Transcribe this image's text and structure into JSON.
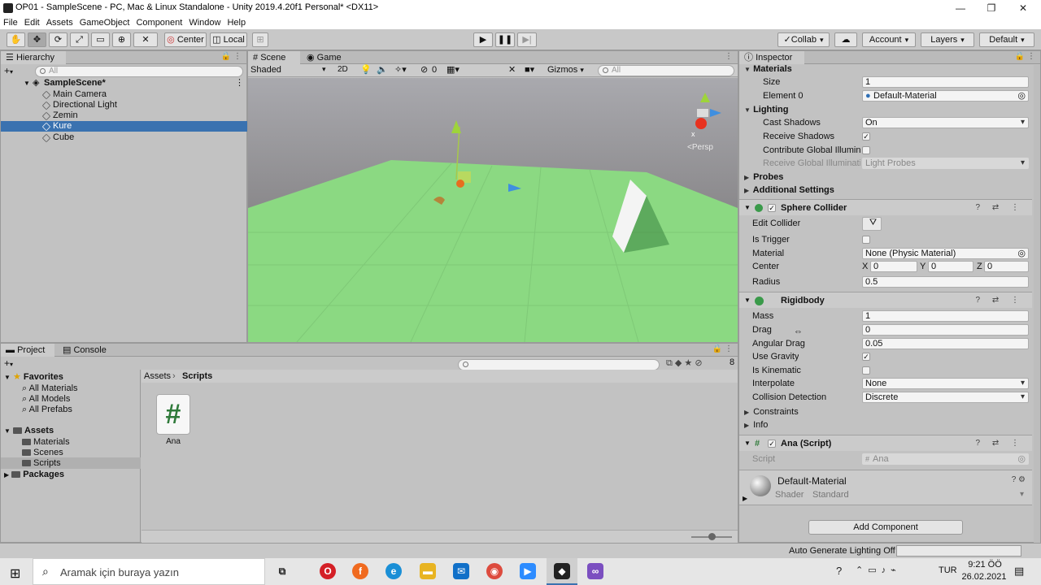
{
  "window": {
    "title": "OP01 - SampleScene - PC, Mac & Linux Standalone - Unity 2019.4.20f1 Personal* <DX11>",
    "minimize": "—",
    "maximize": "❐",
    "close": "✕"
  },
  "menu": [
    "File",
    "Edit",
    "Assets",
    "GameObject",
    "Component",
    "Window",
    "Help"
  ],
  "toolbar": {
    "pivot": "Center",
    "space": "Local",
    "collab": "Collab",
    "account": "Account",
    "layers": "Layers",
    "layout": "Default"
  },
  "hierarchy": {
    "tab": "Hierarchy",
    "add": "+",
    "search_placeholder": "All",
    "scene": "SampleScene*",
    "items": [
      "Main Camera",
      "Directional Light",
      "Zemin",
      "Kure",
      "Cube"
    ],
    "selected": "Kure"
  },
  "scene_view": {
    "tabs": [
      "Scene",
      "Game"
    ],
    "shading": "Shaded",
    "mode2d": "2D",
    "fx_count": "0",
    "gizmos": "Gizmos",
    "search_placeholder": "All",
    "persp": "<Persp",
    "axis_x": "x",
    "colors": {
      "sky": "#8a8a8f",
      "ground": "#8bd982",
      "horizon": "#58534f"
    }
  },
  "project": {
    "tabs": [
      "Project",
      "Console"
    ],
    "add": "+",
    "count": "8",
    "favorites_label": "Favorites",
    "favorites": [
      "All Materials",
      "All Models",
      "All Prefabs"
    ],
    "assets_label": "Assets",
    "assets": [
      "Materials",
      "Scenes",
      "Scripts"
    ],
    "packages_label": "Packages",
    "breadcrumb": [
      "Assets",
      "Scripts"
    ],
    "file_name": "Ana",
    "file_glyph": "#"
  },
  "inspector": {
    "tab": "Inspector",
    "materials": {
      "label": "Materials",
      "size_label": "Size",
      "size": "1",
      "element_label": "Element 0",
      "element": "Default-Material"
    },
    "lighting": {
      "label": "Lighting",
      "cast_shadows_label": "Cast Shadows",
      "cast_shadows": "On",
      "receive_shadows_label": "Receive Shadows",
      "contribute_gi_label": "Contribute Global Illumina",
      "receive_gi_label": "Receive Global Illuminati",
      "receive_gi": "Light Probes"
    },
    "probes": "Probes",
    "additional_settings": "Additional Settings",
    "sphere_collider": {
      "title": "Sphere Collider",
      "edit_collider": "Edit Collider",
      "is_trigger": "Is Trigger",
      "material_label": "Material",
      "material": "None (Physic Material)",
      "center_label": "Center",
      "x_label": "X",
      "x": "0",
      "y_label": "Y",
      "y": "0",
      "z_label": "Z",
      "z": "0",
      "radius_label": "Radius",
      "radius": "0.5"
    },
    "rigidbody": {
      "title": "Rigidbody",
      "mass_label": "Mass",
      "mass": "1",
      "drag_label": "Drag",
      "drag": "0",
      "angular_drag_label": "Angular Drag",
      "angular_drag": "0.05",
      "use_gravity_label": "Use Gravity",
      "is_kinematic_label": "Is Kinematic",
      "interpolate_label": "Interpolate",
      "interpolate": "None",
      "collision_label": "Collision Detection",
      "collision": "Discrete",
      "constraints": "Constraints",
      "info": "Info"
    },
    "script": {
      "title": "Ana (Script)",
      "script_label": "Script",
      "script_value": "Ana"
    },
    "material_preview": {
      "name": "Default-Material",
      "shader_label": "Shader",
      "shader": "Standard"
    },
    "add_component": "Add Component"
  },
  "status": {
    "lighting": "Auto Generate Lighting Off"
  },
  "taskbar": {
    "search": "Aramak için buraya yazın",
    "lang": "TUR",
    "time": "9:21 ÖÖ",
    "date": "26.02.2021"
  }
}
